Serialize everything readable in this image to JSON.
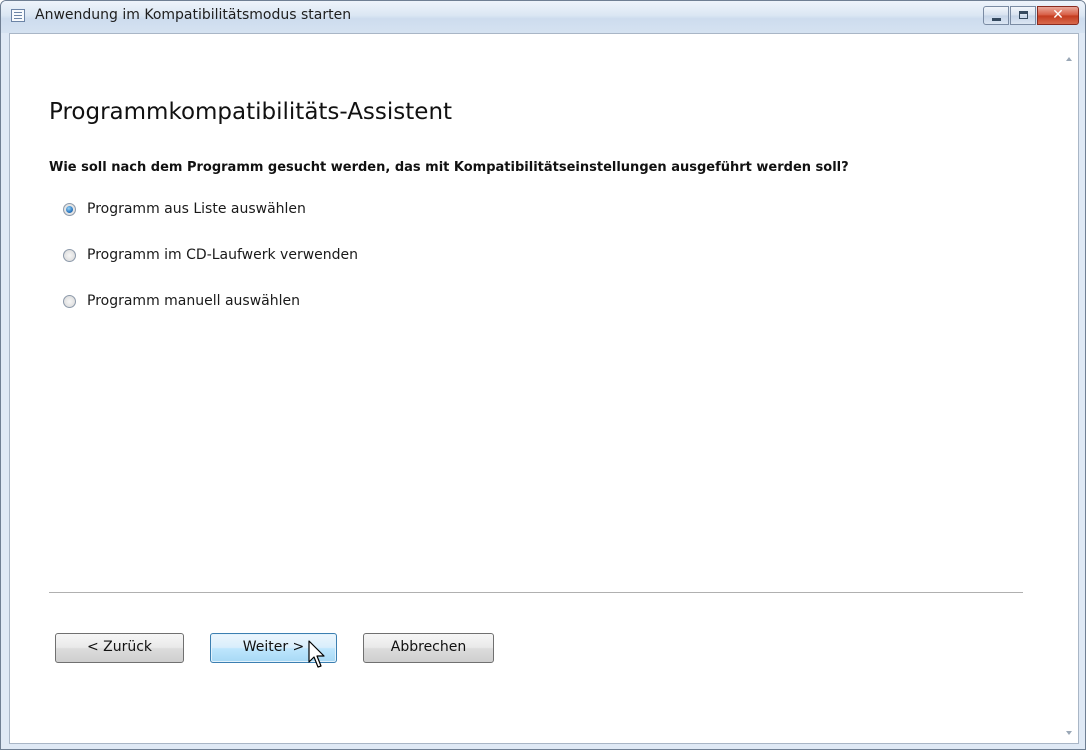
{
  "window": {
    "title": "Anwendung im Kompatibilitätsmodus starten",
    "controls": {
      "minimize": "minimize-icon",
      "maximize": "maximize-icon",
      "close": "✕"
    }
  },
  "wizard": {
    "heading": "Programmkompatibilitäts-Assistent",
    "question": "Wie soll nach dem Programm gesucht werden, das mit Kompatibilitätseinstellungen ausgeführt werden soll?",
    "options": [
      {
        "label": "Programm aus Liste auswählen",
        "checked": true
      },
      {
        "label": "Programm im CD-Laufwerk verwenden",
        "checked": false
      },
      {
        "label": "Programm manuell auswählen",
        "checked": false
      }
    ]
  },
  "buttons": {
    "back": "< Zurück",
    "next": "Weiter >",
    "cancel": "Abbrechen"
  },
  "colors": {
    "accent": "#3c7fb1",
    "close_button": "#c33a1e",
    "titlebar": "#d5e2f1"
  }
}
